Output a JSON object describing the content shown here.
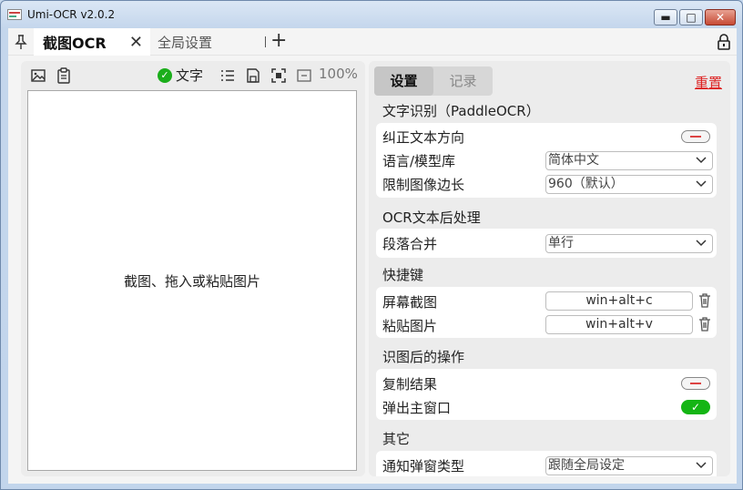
{
  "window": {
    "title": "Umi-OCR v2.0.2"
  },
  "tabs": [
    {
      "label": "截图OCR"
    },
    {
      "label": "全局设置"
    }
  ],
  "left_panel": {
    "text_toggle_label": "文字",
    "zoom": "100%",
    "hint": "截图、拖入或粘贴图片"
  },
  "right_panel": {
    "seg_settings": "设置",
    "seg_records": "记录",
    "reset": "重置",
    "sections": {
      "ocr": {
        "title": "文字识别（PaddleOCR）",
        "correct_direction": "纠正文本方向",
        "language_label": "语言/模型库",
        "language_value": "简体中文",
        "limit_label": "限制图像边长",
        "limit_value": "960（默认）"
      },
      "post": {
        "title": "OCR文本后处理",
        "merge_label": "段落合并",
        "merge_value": "单行"
      },
      "hotkeys": {
        "title": "快捷键",
        "screenshot_label": "屏幕截图",
        "screenshot_value": "win+alt+c",
        "paste_label": "粘贴图片",
        "paste_value": "win+alt+v"
      },
      "after": {
        "title": "识图后的操作",
        "copy_label": "复制结果",
        "popup_label": "弹出主窗口"
      },
      "other": {
        "title": "其它",
        "notify_label": "通知弹窗类型",
        "notify_value": "跟随全局设定"
      }
    }
  },
  "colors": {
    "accent_green": "#14b514",
    "reset_red": "#dd2222"
  }
}
